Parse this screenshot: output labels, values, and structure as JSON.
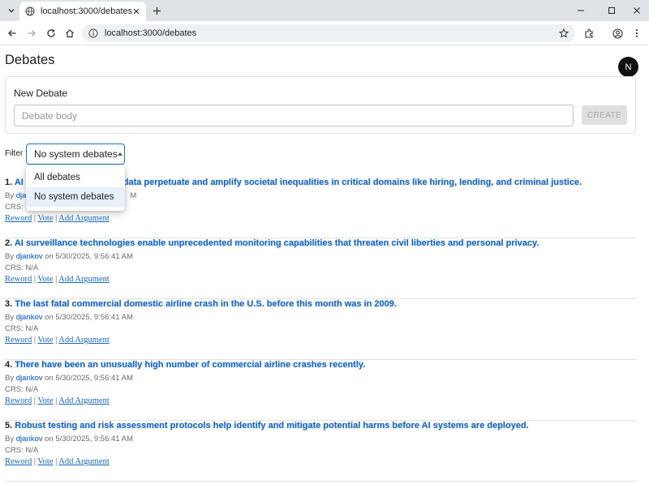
{
  "browser": {
    "tab_title": "localhost:3000/debates",
    "url": "localhost:3000/debates"
  },
  "page": {
    "title": "Debates",
    "badge": "N"
  },
  "new_debate": {
    "title": "New Debate",
    "placeholder": "Debate body",
    "create_label": "CREATE"
  },
  "filter": {
    "label": "Filter",
    "selected": "No system debates",
    "options": [
      "All debates",
      "No system debates"
    ]
  },
  "debates": [
    {
      "num": "1.",
      "title_visible": "AI",
      "title_tail": "ed data perpetuate and amplify societal inequalities in critical domains like hiring, lending, and criminal justice.",
      "by": "By",
      "author": "dja",
      "on": "M",
      "crs": "CRS: N",
      "actions": [
        "Reword",
        "Vote",
        "Add Argument"
      ]
    },
    {
      "num": "2.",
      "title": "AI surveillance technologies enable unprecedented monitoring capabilities that threaten civil liberties and personal privacy.",
      "by": "By",
      "author": "djankov",
      "on": "on 5/30/2025, 9:56:41 AM",
      "crs": "CRS: N/A",
      "actions": [
        "Reword",
        "Vote",
        "Add Argument"
      ]
    },
    {
      "num": "3.",
      "title": "The last fatal commercial domestic airline crash in the U.S. before this month was in 2009.",
      "by": "By",
      "author": "djankov",
      "on": "on 5/30/2025, 9:56:41 AM",
      "crs": "CRS: N/A",
      "actions": [
        "Reword",
        "Vote",
        "Add Argument"
      ]
    },
    {
      "num": "4.",
      "title": "There have been an unusually high number of commercial airline crashes recently.",
      "by": "By",
      "author": "djankov",
      "on": "on 5/30/2025, 9:56:41 AM",
      "crs": "CRS: N/A",
      "actions": [
        "Reword",
        "Vote",
        "Add Argument"
      ]
    },
    {
      "num": "5.",
      "title": "Robust testing and risk assessment protocols help identify and mitigate potential harms before AI systems are deployed.",
      "by": "By",
      "author": "djankov",
      "on": "on 5/30/2025, 9:56:41 AM",
      "crs": "CRS: N/A",
      "actions": [
        "Reword",
        "Vote",
        "Add Argument"
      ]
    }
  ]
}
